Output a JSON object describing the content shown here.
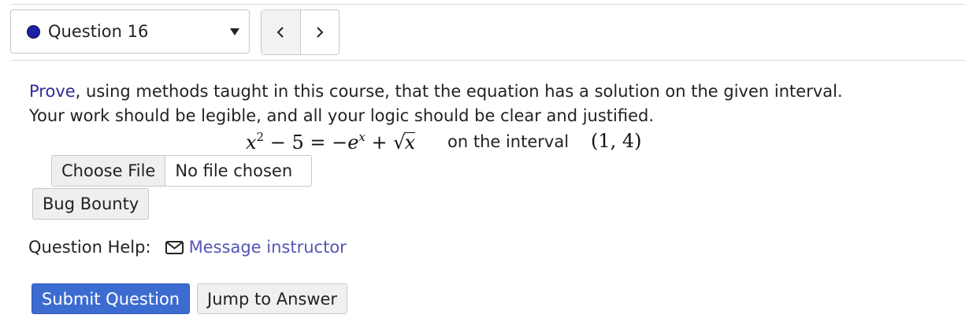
{
  "question_selector": {
    "label": "Question 16",
    "status_color": "#1f1fa8"
  },
  "navigation": {
    "prev_icon": "chevron-left-icon",
    "next_icon": "chevron-right-icon"
  },
  "prompt": {
    "link_text": "Prove",
    "line1_rest": ", using methods taught in this course, that the equation has a solution on the given interval.",
    "line2": "Your work should be legible, and all your logic should be clear and justified."
  },
  "equation": {
    "lhs_var": "x",
    "lhs_exp": "2",
    "lhs_rest": " − 5 = −",
    "e_base": "e",
    "e_exp": "x",
    "plus": " + √",
    "sqrt_arg": "x",
    "interval_text": "on the interval",
    "interval": "(1, 4)"
  },
  "file_upload": {
    "button_label": "Choose File",
    "status": "No file chosen"
  },
  "bug_bounty_label": "Bug Bounty",
  "help": {
    "label": "Question Help:",
    "icon": "mail-icon",
    "link": "Message instructor"
  },
  "actions": {
    "submit_label": "Submit Question",
    "jump_label": "Jump to Answer",
    "submit_color": "#3d6cd0"
  }
}
